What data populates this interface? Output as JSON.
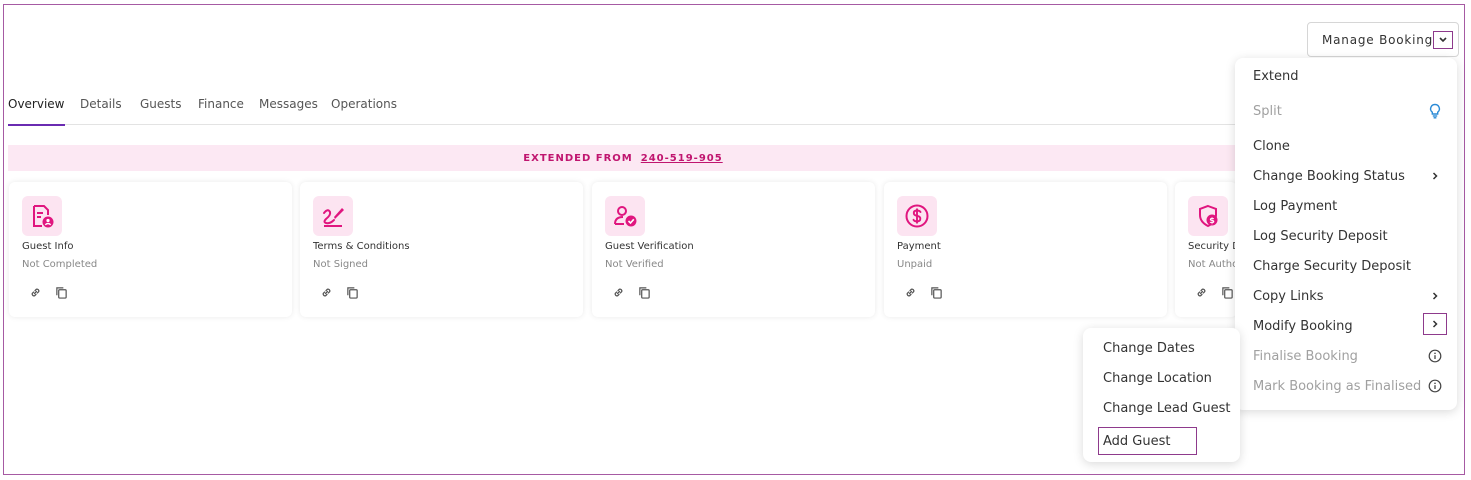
{
  "manage": {
    "label": "Manage Booking"
  },
  "tabs": [
    {
      "label": "Overview",
      "active": true
    },
    {
      "label": "Details"
    },
    {
      "label": "Guests"
    },
    {
      "label": "Finance"
    },
    {
      "label": "Messages"
    },
    {
      "label": "Operations"
    }
  ],
  "banner": {
    "text": "EXTENDED FROM",
    "link": "240-519-905"
  },
  "cards": [
    {
      "title": "Guest Info",
      "status": "Not Completed",
      "icon": "guest-info-icon"
    },
    {
      "title": "Terms & Conditions",
      "status": "Not Signed",
      "icon": "signature-icon"
    },
    {
      "title": "Guest Verification",
      "status": "Not Verified",
      "icon": "user-verified-icon"
    },
    {
      "title": "Payment",
      "status": "Unpaid",
      "icon": "dollar-icon"
    },
    {
      "title": "Security D",
      "status": "Not Autho",
      "icon": "shield-dollar-icon"
    }
  ],
  "menu": {
    "items": [
      {
        "label": "Extend"
      },
      {
        "label": "Split",
        "disabled": true,
        "icon": "lightbulb-icon"
      },
      {
        "label": "Clone"
      },
      {
        "label": "Change Booking Status",
        "icon": "chevron-right-icon"
      },
      {
        "label": "Log Payment"
      },
      {
        "label": "Log Security Deposit"
      },
      {
        "label": "Charge Security Deposit"
      },
      {
        "label": "Copy Links",
        "icon": "chevron-right-icon"
      },
      {
        "label": "Modify Booking",
        "icon": "chevron-right-icon"
      },
      {
        "label": "Finalise Booking",
        "disabled": true,
        "icon": "info-icon"
      },
      {
        "label": "Mark Booking as Finalised",
        "disabled": true,
        "icon": "info-icon"
      }
    ]
  },
  "submenu": {
    "items": [
      {
        "label": "Change Dates"
      },
      {
        "label": "Change Location"
      },
      {
        "label": "Change Lead Guest"
      },
      {
        "label": "Add Guest"
      }
    ]
  },
  "colors": {
    "accent": "#e0167f",
    "tile": "#fce4f1",
    "focus": "#8e3a8c",
    "tab_underline": "#6a2bb1"
  }
}
